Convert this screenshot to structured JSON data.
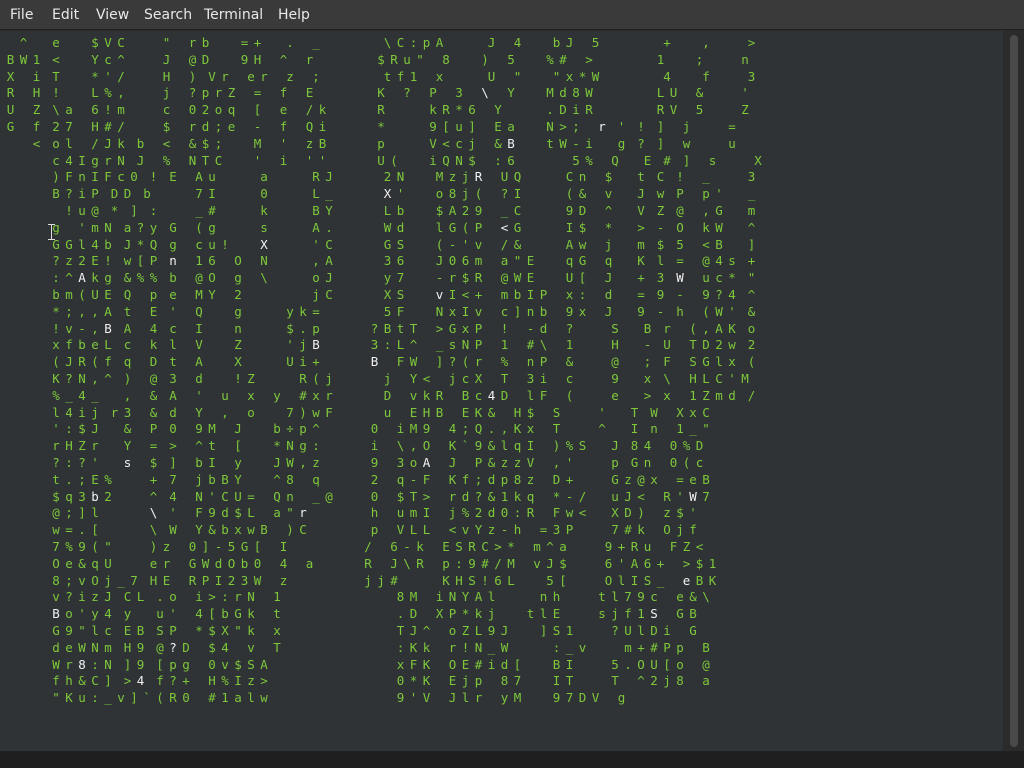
{
  "menubar": {
    "items": [
      "File",
      "Edit",
      "View",
      "Search",
      "Terminal",
      "Help"
    ]
  },
  "terminal": {
    "fg_color": "#7ec83a",
    "highlight_color": "#f2f2f2",
    "bg_color": "#2f3336",
    "cursor_icon": "ibeam-cursor-icon",
    "columns": [
      {
        "green": "^XRUG",
        "white": "BW"
      },
      {
        "green": "Wi H Z f<",
        "white": ""
      },
      {
        "green": "eT\\ 27o4Lc ! g G ? : b * ! x ( K % l ' r ? t S @ w 7 0 8 v B G d W f \" K",
        "white": "F"
      },
      {
        "green": "",
        "white": ""
      }
    ],
    "rows": [
      "  ^    e     $ V C      \"   r b     = +    .   _          \\ C : p A       J   4     b J   5          +     ,      >",
      "B W 1  <     Y c ^      J   @ D     9 H   ^   r          $ R u \"   8     )   5     % #   >          1     ;      n",
      "X   i  T     * ' /      H   )  V r   e r   z   ;          t f 1   x       U   \"     \" x * W          4     f      3",
      "R   H  !     L % ,      j   ? p r Z   =   f   E          K   ?   P   3   \\   Y     M d 8 W          L U   &      '",
      "U   Z  \\ a   6 ! m      c   0 2 o q   [   e   / k        R       k R * 6   Y       . D i R          R V   5      Z",
      "G   f  2 7   H # /      $   r d ; e   -   f   Q i        *       9 [ u ]   E a     N > ;   r  '  !  ]   j      =",
      "    <  o l   / J k  b   <   & $ ;     M   '   z B        p       V < c j   & B     t W - i    g  ?  ]   w      u",
      "       c 4 I g r N  J   %   N T C     '   i   ' '        U (     i Q N $   : 6         5 %   Q    E  #  ]   s      X",
      "       ) F n I F c 0  !  E   A u       a       R J        2 N     M z j R   U Q       C n   $    t  C  !   _      3",
      "       B ? i P  D D  b       7 I       0       L _        X '     o 8 j (   ? I       ( &   v    J  w  P   p '    _",
      "         ! u @  *  ]  :      _ #       k       B Y        L b     $ A 2 9   _ C       9 D   ^    V  Z  @   , G    m",
      "       g   ' m N  a ? y  G   ( g       s       A .        W d     l G ( P   < G       I $   *    >  -  O   k W    ^",
      "       G G l 4 b  J * Q  g   c u !     X       ' C        G S     ( - ' v   / &       A w   j    m  $  5   < B    ]",
      "       ? z 2 E !  w [ P  n   1 6   O   N       , A        3 6     J 0 6 m   a \" E     q G   q    K  l  =   @ 4 s  +",
      "       : ^ A k g  & % %  b   @ O   g   \\       o J        y 7     - r $ R   @ W E     U [   J    +  3  W   u c *  \"",
      "       b m ( U E  Q   p  e   M Y   2           j C        X S     v I < +   m b I P   x :   d    =  9  -   9 ? 4  ^",
      "       * ; , , A  t   E  '   Q     g       y k =          5 F     N x I v   c ] n b   9 x   J    9  -  h   ( W '  &",
      "       ! v - , B  A   4  c   I     n       $ . p        ? B t T   > G x P   !   - d   ?      S    B  r   ( , A K  o",
      "       x f b e L  c   k  l   V     Z       ' j B        3 : L ^   _ s N P   1   # \\   1      H    -  U   T D 2 w  2",
      "       ( J R ( f  q   D  t   A     X       U i +        B   F W   ] ? ( r   %   n P   &      @    ;  F   S G l x  (",
      "       K ? N , ^  )   @  3   d     ! Z       R ( j        j   Y <   j c X   T   3 i   c      9    x  \\   H L C ' M",
      "       % _ 4 _    ,   &  A   '   u   x   y   # x r        D   v k R   B c 4 D   l F   (      e    >  x   1 Z m d  /",
      "       l 4 i j  r 3   &  d   Y   ,   o     7 ) w F        u   E H B   E K &   H $   S      '    T  W   X x C",
      "       ' : $ J    &   P  0   9 M   J     b ÷ p ^        0   i M 9   4 ; Q . , K x   T      ^    I  n   1 _ \"",
      "       r H Z r    Y   =  >   ^ t   [     * N g :        i   \\ , O   K ` 9 & l q I   ) % S    J  8 4   0 % D",
      "       ? : ? '    s   $  ]   b I   y     J W , z        9   3 o A   J   P & z z V   , '      p  G n   0 ( c",
      "       t . ; E %      +  7   j b B Y     ^ 8   q        2   q - F   K f ; d p 8 z   D +      G z @ x   = e B",
      "       $ q 3 b 2      ^  4   N ' C U =   Q n   _ @      0   $ T >   r d ? & 1 k q   * - /    u J <   R ' W 7",
      "       @ ; ] l        \\  '   F 9 d $ L   a \" r          h   u m I   j % 2 d 0 : R   F w <    X D )   z $ '",
      "       w = . [        \\  W   Y & b x w B   ) C          p   V L L   < v Y z - h   = 3 P      7 # k   O j f",
      "       7 % 9 ( \"      ) z   0 ] - 5 G [   I            /   6 - k   E S R C > *   m ^ a      9 + R u   F Z <",
      "       O e & q U      e r   G W d O b 0   4   a        R   J \\ R   p : 9 # / M   v J $      6 ' A 6 +   > $ 1",
      "       8 ; v O j _ 7  H E   R P I 2 3 W   z            j j #       K H S ! 6 L     5 [      O l I S _   e B K",
      "       v ? i z J  C L  . o   i > : r N   1                  8 M   i N Y A l       n h      t l 7 9 c   e & \\",
      "       B o ' y 4  y    u '   4 [ b G k   t                  . D   X P * k j     t l E      s j f 1 S   G B",
      "       G 9 \" l c  E B  S P   * $ X \" k   x                  T J ^   o Z L 9 J     ] S 1      ? U l D i   G",
      "       d e W N m  H 9  @ ? D   $ 4   v   T                  : K k   r ! N _ W       : _ v      m + # P p   B",
      "       W r 8 : N  ] 9  [ p g   0 v $ S A                    x F K   O E # i d [     B I      5 . O U [ o   @",
      "       f h & C ]  > 4  f ? +   H % I z >                    0 * K   E j p   8 7     I T      T   ^ 2 j 8   a",
      "       \" K u : _ v ] ` ( R 0   # 1 a l w                    9 ' V   J l r   y M     9 7 D V   g"
    ]
  }
}
